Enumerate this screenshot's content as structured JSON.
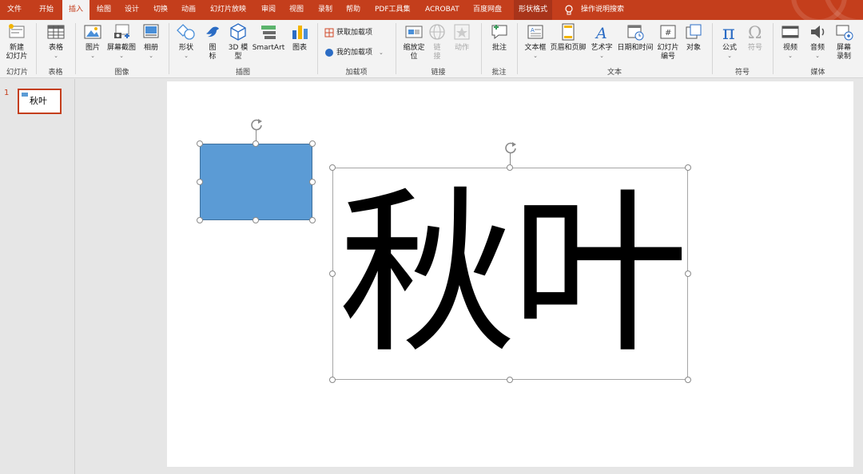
{
  "tabs": [
    "文件",
    "开始",
    "插入",
    "绘图",
    "设计",
    "切换",
    "动画",
    "幻灯片放映",
    "审阅",
    "视图",
    "录制",
    "帮助",
    "PDF工具集",
    "ACROBAT",
    "百度网盘",
    "形状格式"
  ],
  "tell_me": "操作说明搜索",
  "ribbon": {
    "slides": {
      "label": "幻灯片",
      "new_slide_1": "新建",
      "new_slide_2": "幻灯片"
    },
    "tables": {
      "label": "表格",
      "table": "表格"
    },
    "images": {
      "label": "图像",
      "picture": "图片",
      "screenshot": "屏幕截图",
      "album": "相册"
    },
    "illustrations": {
      "label": "插图",
      "shapes": "形状",
      "icons_1": "图",
      "icons_2": "标",
      "model_1": "3D 模",
      "model_2": "型",
      "smartart": "SmartArt",
      "chart": "图表"
    },
    "addins": {
      "label": "加载项",
      "get": "获取加载项",
      "mine": "我的加载项"
    },
    "links": {
      "label": "链接",
      "zoom_1": "缩放定",
      "zoom_2": "位",
      "link_1": "链",
      "link_2": "接",
      "action": "动作"
    },
    "comments": {
      "label": "批注",
      "comment": "批注"
    },
    "text": {
      "label": "文本",
      "textbox": "文本框",
      "header": "页眉和页脚",
      "wordart": "艺术字",
      "datetime": "日期和时间",
      "slidenum_1": "幻灯片",
      "slidenum_2": "编号",
      "object": "对象"
    },
    "symbols": {
      "label": "符号",
      "equation": "公式",
      "symbol": "符号"
    },
    "media": {
      "label": "媒体",
      "video": "视频",
      "audio": "音频",
      "record_1": "屏幕",
      "record_2": "录制"
    }
  },
  "slide_pane": {
    "number": "1",
    "thumb_text": "秋叶"
  },
  "slide": {
    "text": "秋叶",
    "rect_color": "#5b9bd5"
  },
  "colors": {
    "accent": "#c43e1c",
    "shape_fill": "#5b9bd5"
  }
}
